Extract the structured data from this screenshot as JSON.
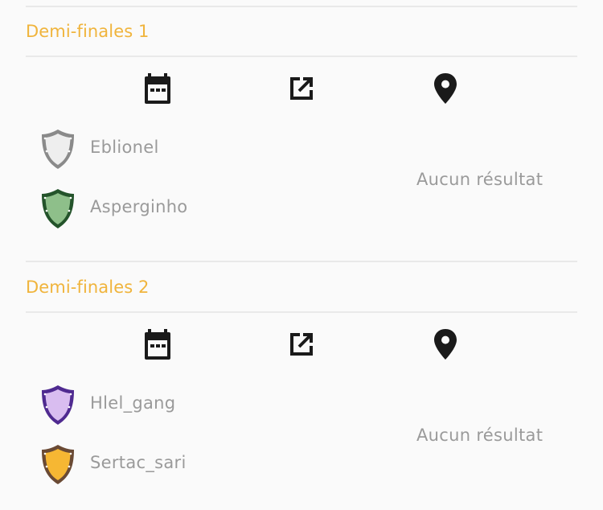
{
  "matches": [
    {
      "round_title": "Demi-finales 1",
      "icons": [
        "calendar-icon",
        "open-in-new-icon",
        "location-pin-icon"
      ],
      "teams": [
        {
          "name": "Eblionel",
          "shield_fill": "#eeeeee",
          "shield_stroke": "#8a8a8a"
        },
        {
          "name": "Asperginho",
          "shield_fill": "#8ebf8a",
          "shield_stroke": "#23532a"
        }
      ],
      "result": "Aucun résultat"
    },
    {
      "round_title": "Demi-finales 2",
      "icons": [
        "calendar-icon",
        "open-in-new-icon",
        "location-pin-icon"
      ],
      "teams": [
        {
          "name": "Hlel_gang",
          "shield_fill": "#d9bdf0",
          "shield_stroke": "#4f2a90"
        },
        {
          "name": "Sertac_sari",
          "shield_fill": "#f6b733",
          "shield_stroke": "#6a4a34"
        }
      ],
      "result": "Aucun résultat"
    }
  ],
  "colors": {
    "accent": "#f0b43c",
    "muted_text": "#9a9a9a",
    "divider": "#e9e9e9",
    "icon": "#1a1a1a"
  }
}
